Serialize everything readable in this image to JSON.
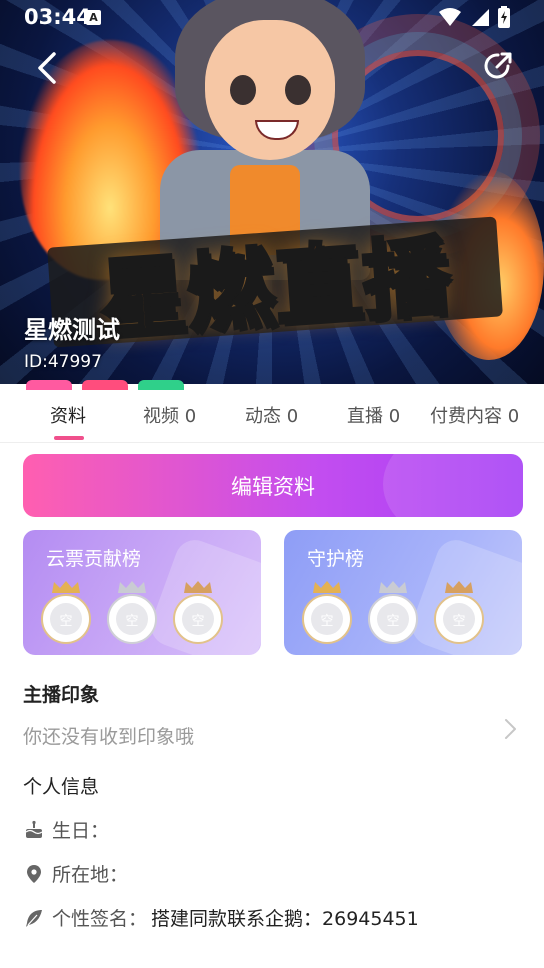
{
  "status_bar": {
    "time": "03:44",
    "notify_icon": "A"
  },
  "header": {
    "banner_logo_text": "星燃直播",
    "user_name": "星燃测试",
    "user_id": "ID:47997"
  },
  "tabs": [
    {
      "label": "资料",
      "active": true
    },
    {
      "label": "视频 0"
    },
    {
      "label": "动态 0"
    },
    {
      "label": "直播 0"
    },
    {
      "label": "付费内容 0"
    }
  ],
  "edit_button": {
    "label": "编辑资料"
  },
  "rank_cards": {
    "ticket": {
      "title": "云票贡献榜",
      "slots": [
        "空",
        "空",
        "空"
      ]
    },
    "guard": {
      "title": "守护榜",
      "slots": [
        "空",
        "空",
        "空"
      ]
    }
  },
  "impressions": {
    "title": "主播印象",
    "empty_text": "你还没有收到印象哦"
  },
  "personal_info": {
    "title": "个人信息",
    "birthday_label": "生日：",
    "location_label": "所在地：",
    "signature_label": "个性签名：",
    "signature_value": "搭建同款联系企鹅：26945451"
  },
  "colors": {
    "accent": "#f0508c",
    "edit_start": "#ff5fb0",
    "edit_end": "#a53cf5"
  }
}
